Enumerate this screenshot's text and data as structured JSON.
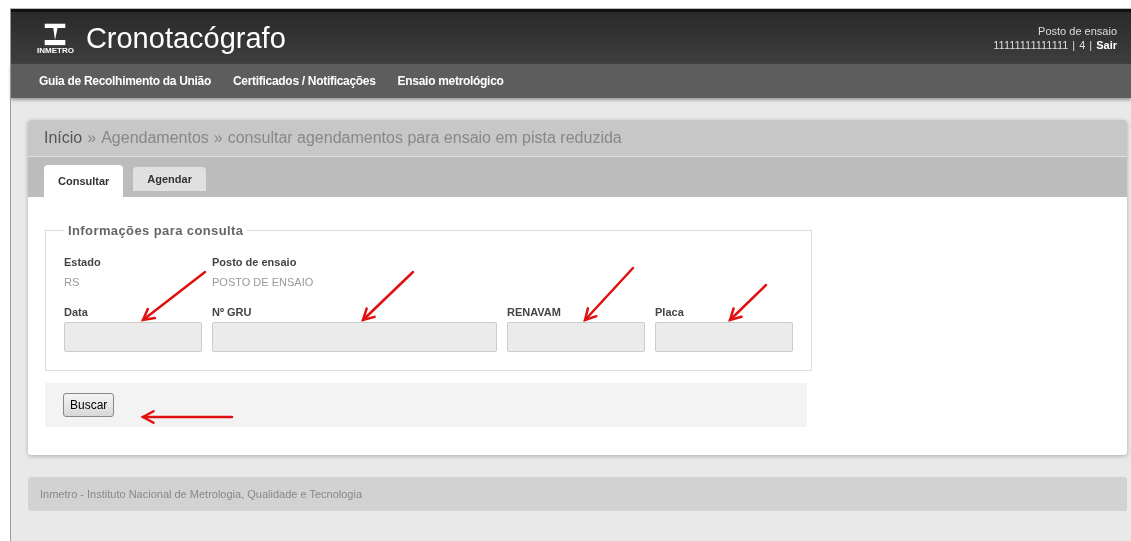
{
  "header": {
    "title": "Cronotacógrafo",
    "logo_text": "INMETRO",
    "user_label": "Posto de ensaio",
    "user_id": "11111111111111",
    "separator_1": "|",
    "user_number": "4",
    "separator_2": "|",
    "logout": "Sair"
  },
  "nav": [
    {
      "label": "Guia de Recolhimento da União"
    },
    {
      "label": "Certificados / Notificações"
    },
    {
      "label": "Ensaio metrológico"
    }
  ],
  "breadcrumb": [
    {
      "label": "Início",
      "kind": "link"
    },
    {
      "label": "»",
      "kind": "sep"
    },
    {
      "label": "Agendamentos",
      "kind": "text"
    },
    {
      "label": "»",
      "kind": "sep"
    },
    {
      "label": "consultar agendamentos para ensaio em pista reduzida",
      "kind": "text"
    }
  ],
  "tabs": [
    {
      "label": "Consultar",
      "selected": true
    },
    {
      "label": "Agendar",
      "selected": false
    }
  ],
  "fieldset": {
    "legend": "Informações para consulta",
    "info": [
      {
        "label": "Estado",
        "value": "RS"
      },
      {
        "label": "Posto de ensaio",
        "value": "POSTO DE ENSAIO"
      }
    ],
    "fields": [
      {
        "label": "Data"
      },
      {
        "label": "Nº GRU"
      },
      {
        "label": "RENAVAM"
      },
      {
        "label": "Placa"
      }
    ]
  },
  "button": "Buscar",
  "footer": "Inmetro - Instituto Nacional de Metrologia, Qualidade e Tecnologia"
}
